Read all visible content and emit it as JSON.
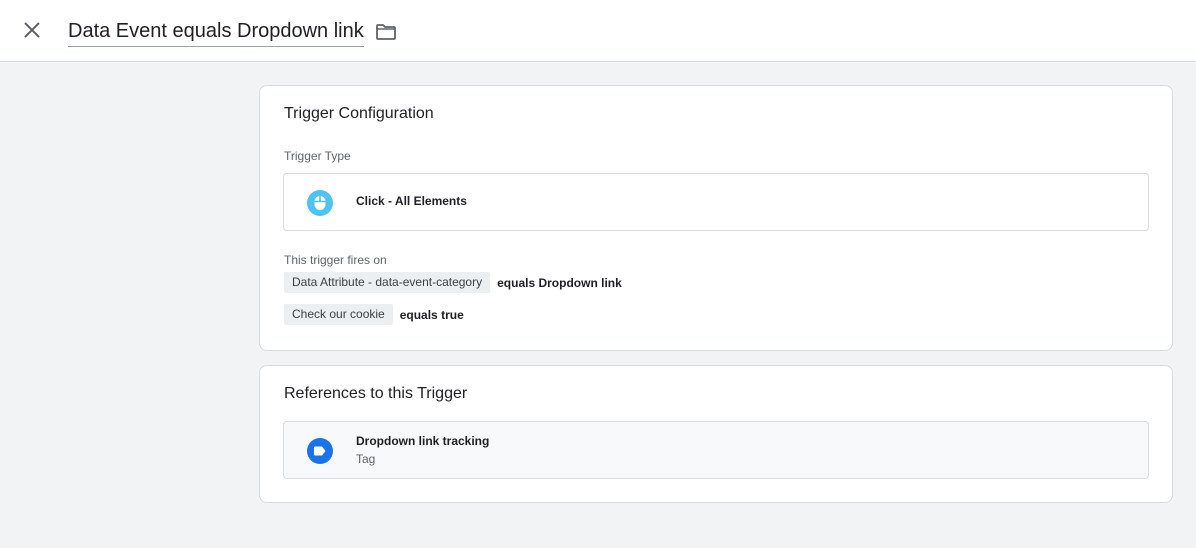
{
  "header": {
    "title": "Data Event equals Dropdown link",
    "close_icon": "close-icon",
    "folder_icon": "folder-icon"
  },
  "config": {
    "card_title": "Trigger Configuration",
    "type_label": "Trigger Type",
    "type_name": "Click - All Elements",
    "type_icon": "mouse-icon",
    "fires_label": "This trigger fires on",
    "conditions": [
      {
        "variable": "Data Attribute - data-event-category",
        "rest": "equals Dropdown link"
      },
      {
        "variable": "Check our cookie",
        "rest": "equals true"
      }
    ]
  },
  "refs": {
    "card_title": "References to this Trigger",
    "items": [
      {
        "name": "Dropdown link tracking",
        "type": "Tag",
        "icon": "tag-icon"
      }
    ]
  },
  "colors": {
    "background": "#f1f3f4",
    "click_icon": "#4fc3f7",
    "tag_icon": "#1a73e8"
  }
}
